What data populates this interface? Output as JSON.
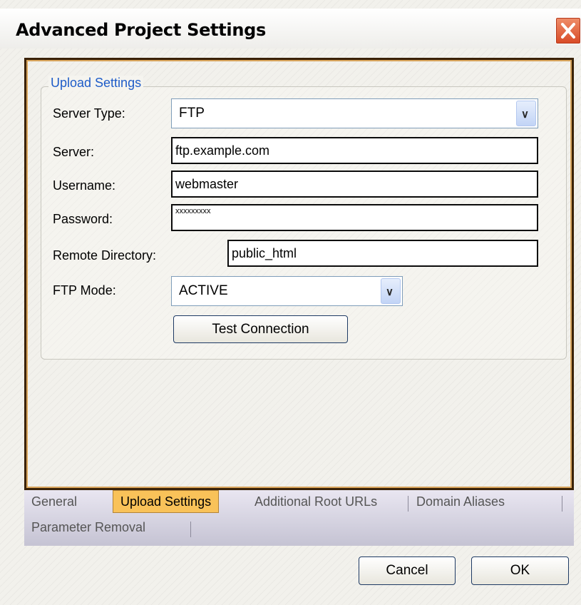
{
  "window": {
    "title": "Advanced Project Settings",
    "close_icon": "close-icon"
  },
  "upload": {
    "group_title": "Upload Settings",
    "server_type": {
      "label": "Server Type:",
      "value": "FTP"
    },
    "server": {
      "label": "Server:",
      "value": "ftp.example.com"
    },
    "username": {
      "label": "Username:",
      "value": "webmaster"
    },
    "password": {
      "label": "Password:",
      "value": "xxxxxxxxx"
    },
    "remote_directory": {
      "label": "Remote Directory:",
      "value": "public_html"
    },
    "ftp_mode": {
      "label": "FTP Mode:",
      "value": "ACTIVE"
    },
    "test_connection_label": "Test Connection"
  },
  "tabs": [
    {
      "label": "General",
      "active": false
    },
    {
      "label": "Upload Settings",
      "active": true
    },
    {
      "label": "Additional Root URLs",
      "active": false
    },
    {
      "label": "Domain Aliases",
      "active": false
    },
    {
      "label": "Parameter Removal",
      "active": false
    }
  ],
  "buttons": {
    "cancel_label": "Cancel",
    "ok_label": "OK"
  },
  "colors": {
    "accent_blue": "#1e5cc8",
    "active_tab": "#f9c259",
    "close_red": "#d84a26"
  }
}
